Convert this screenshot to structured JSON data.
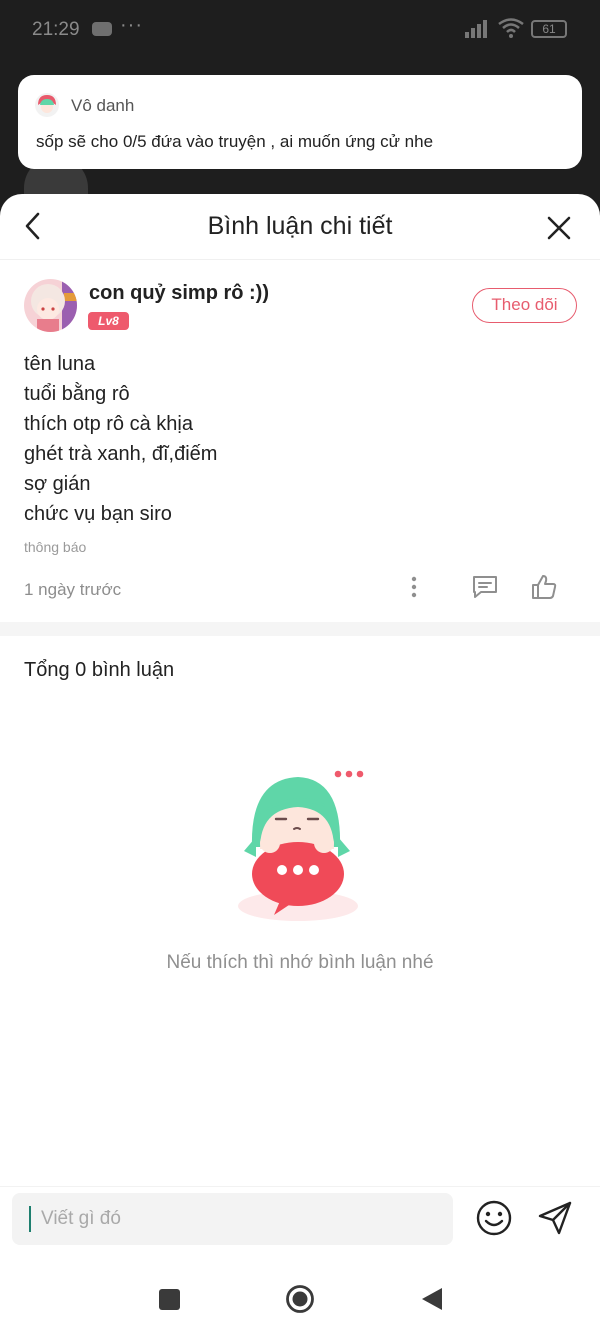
{
  "status_bar": {
    "time": "21:29",
    "battery": "61"
  },
  "notification": {
    "app_name": "Vô danh",
    "message": "sốp sẽ cho 0/5 đứa vào truyện , ai muốn ứng cử nhe"
  },
  "header": {
    "title": "Bình luận chi tiết"
  },
  "post": {
    "author": "con quỷ simp rô :))",
    "level": "Lv8",
    "follow_label": "Theo dõi",
    "lines": [
      "tên luna",
      "tuổi bằng rô",
      "thích otp rô cà khịa",
      "ghét trà xanh, đĩ,điếm",
      "sợ gián",
      "chức vụ bạn siro"
    ],
    "tag": "thông báo",
    "time_ago": "1 ngày trước"
  },
  "comments": {
    "total_label": "Tổng 0 bình luận",
    "empty_message": "Nếu thích thì nhớ bình luận nhé"
  },
  "composer": {
    "placeholder": "Viết gì đó"
  },
  "colors": {
    "accent": "#e75c6e",
    "level_badge": "#ee5a6d",
    "mascot_hair": "#5fd6a8",
    "mascot_bubble": "#f04a58"
  }
}
